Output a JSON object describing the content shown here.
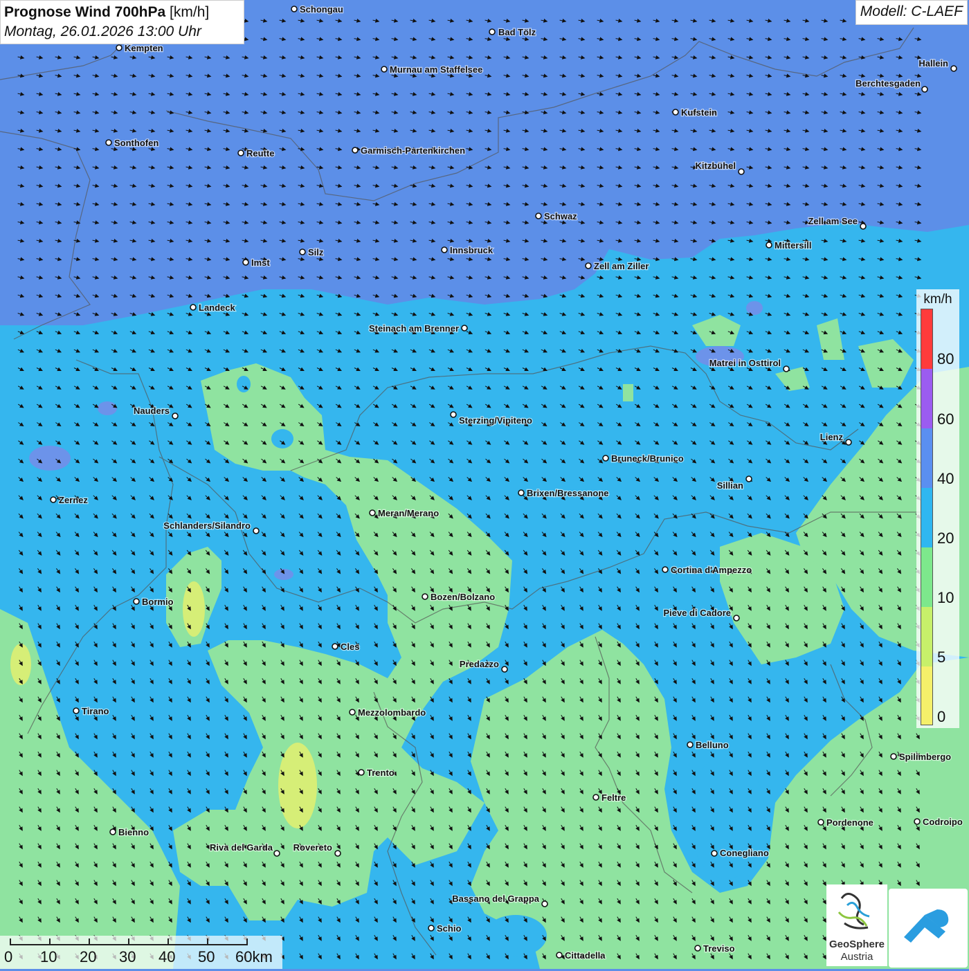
{
  "title": {
    "main": "Prognose Wind 700hPa",
    "unit": "[km/h]",
    "datetime": "Montag, 26.01.2026 13:00 Uhr"
  },
  "model": "Modell: C-LAEF",
  "legend": {
    "unit": "km/h",
    "ticks": [
      "80",
      "60",
      "40",
      "20",
      "10",
      "5",
      "0"
    ],
    "colors": [
      "#ff3b3b",
      "#9b5cf0",
      "#5a8ff0",
      "#2fb7f0",
      "#7de88c",
      "#c7f06a",
      "#f5f06a"
    ]
  },
  "scale": {
    "labels": [
      "0",
      "10",
      "20",
      "30",
      "40",
      "50",
      "60km"
    ]
  },
  "logos": {
    "geosphere_line1": "GeoSphere",
    "geosphere_line2": "Austria"
  },
  "wind": {
    "north_dir_deg": 12,
    "south_dir_deg": 60
  },
  "places": [
    {
      "name": "Schongau"
    },
    {
      "name": "Bad Tölz"
    },
    {
      "name": "Kempten"
    },
    {
      "name": "Murnau am Staffelsee"
    },
    {
      "name": "Hallein"
    },
    {
      "name": "Berchtesgaden"
    },
    {
      "name": "Kufstein"
    },
    {
      "name": "Sonthofen"
    },
    {
      "name": "Reutte"
    },
    {
      "name": "Garmisch-Partenkirchen"
    },
    {
      "name": "Kitzbühel"
    },
    {
      "name": "Schwaz"
    },
    {
      "name": "Zell am See"
    },
    {
      "name": "Mittersill"
    },
    {
      "name": "Silz"
    },
    {
      "name": "Innsbruck"
    },
    {
      "name": "Imst"
    },
    {
      "name": "Zell am Ziller"
    },
    {
      "name": "Landeck"
    },
    {
      "name": "Steinach am Brenner"
    },
    {
      "name": "Matrei in Osttirol"
    },
    {
      "name": "Nauders"
    },
    {
      "name": "Sterzing/Vipiteno"
    },
    {
      "name": "Lienz"
    },
    {
      "name": "Bruneck/Brunico"
    },
    {
      "name": "Sillian"
    },
    {
      "name": "Brixen/Bressanone"
    },
    {
      "name": "Zernez"
    },
    {
      "name": "Meran/Merano"
    },
    {
      "name": "Schlanders/Silandro"
    },
    {
      "name": "Cortina d'Ampezzo"
    },
    {
      "name": "Bozen/Bolzano"
    },
    {
      "name": "Bormio"
    },
    {
      "name": "Pieve di Cadore"
    },
    {
      "name": "Cles"
    },
    {
      "name": "Predazzo"
    },
    {
      "name": "Tirano"
    },
    {
      "name": "Mezzolombardo"
    },
    {
      "name": "Belluno"
    },
    {
      "name": "Spilimbergo"
    },
    {
      "name": "Trento"
    },
    {
      "name": "Feltre"
    },
    {
      "name": "Bienno"
    },
    {
      "name": "Pordenone"
    },
    {
      "name": "Codroipo"
    },
    {
      "name": "Riva del Garda"
    },
    {
      "name": "Rovereto"
    },
    {
      "name": "Conegliano"
    },
    {
      "name": "Bassano del Grappa"
    },
    {
      "name": "Schio"
    },
    {
      "name": "Treviso"
    },
    {
      "name": "Cittadella"
    }
  ]
}
